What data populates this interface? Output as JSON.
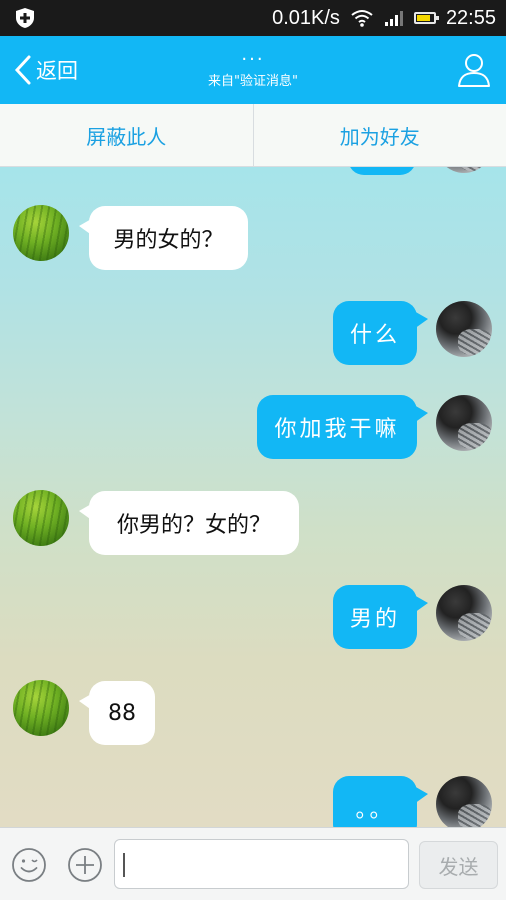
{
  "status_bar": {
    "network_speed": "0.01K/s",
    "time": "22:55",
    "battery_level": 0.75
  },
  "header": {
    "back_label": "返回",
    "title": "...",
    "subtitle": "来自\"验证消息\""
  },
  "actions": {
    "block_label": "屏蔽此人",
    "add_friend_label": "加为好友"
  },
  "messages": [
    {
      "from": "them",
      "text": "男的女的？"
    },
    {
      "from": "me",
      "text": "什么"
    },
    {
      "from": "me",
      "text": "你加我干嘛"
    },
    {
      "from": "them",
      "text": "你男的？女的？"
    },
    {
      "from": "me",
      "text": "男的"
    },
    {
      "from": "them",
      "text": "88"
    },
    {
      "from": "me",
      "text": "。。"
    }
  ],
  "composer": {
    "send_label": "发送",
    "input_value": ""
  },
  "colors": {
    "accent": "#12b7f5",
    "action_text": "#1ba1e2",
    "status_bar": "#1a1a1a"
  },
  "icons": {
    "status_shield": "shield-plus-icon",
    "wifi": "wifi-icon",
    "signal": "signal-icon",
    "battery": "battery-icon",
    "back": "chevron-left-icon",
    "profile": "person-icon",
    "emoji": "smiley-icon",
    "plus": "plus-circle-icon"
  }
}
